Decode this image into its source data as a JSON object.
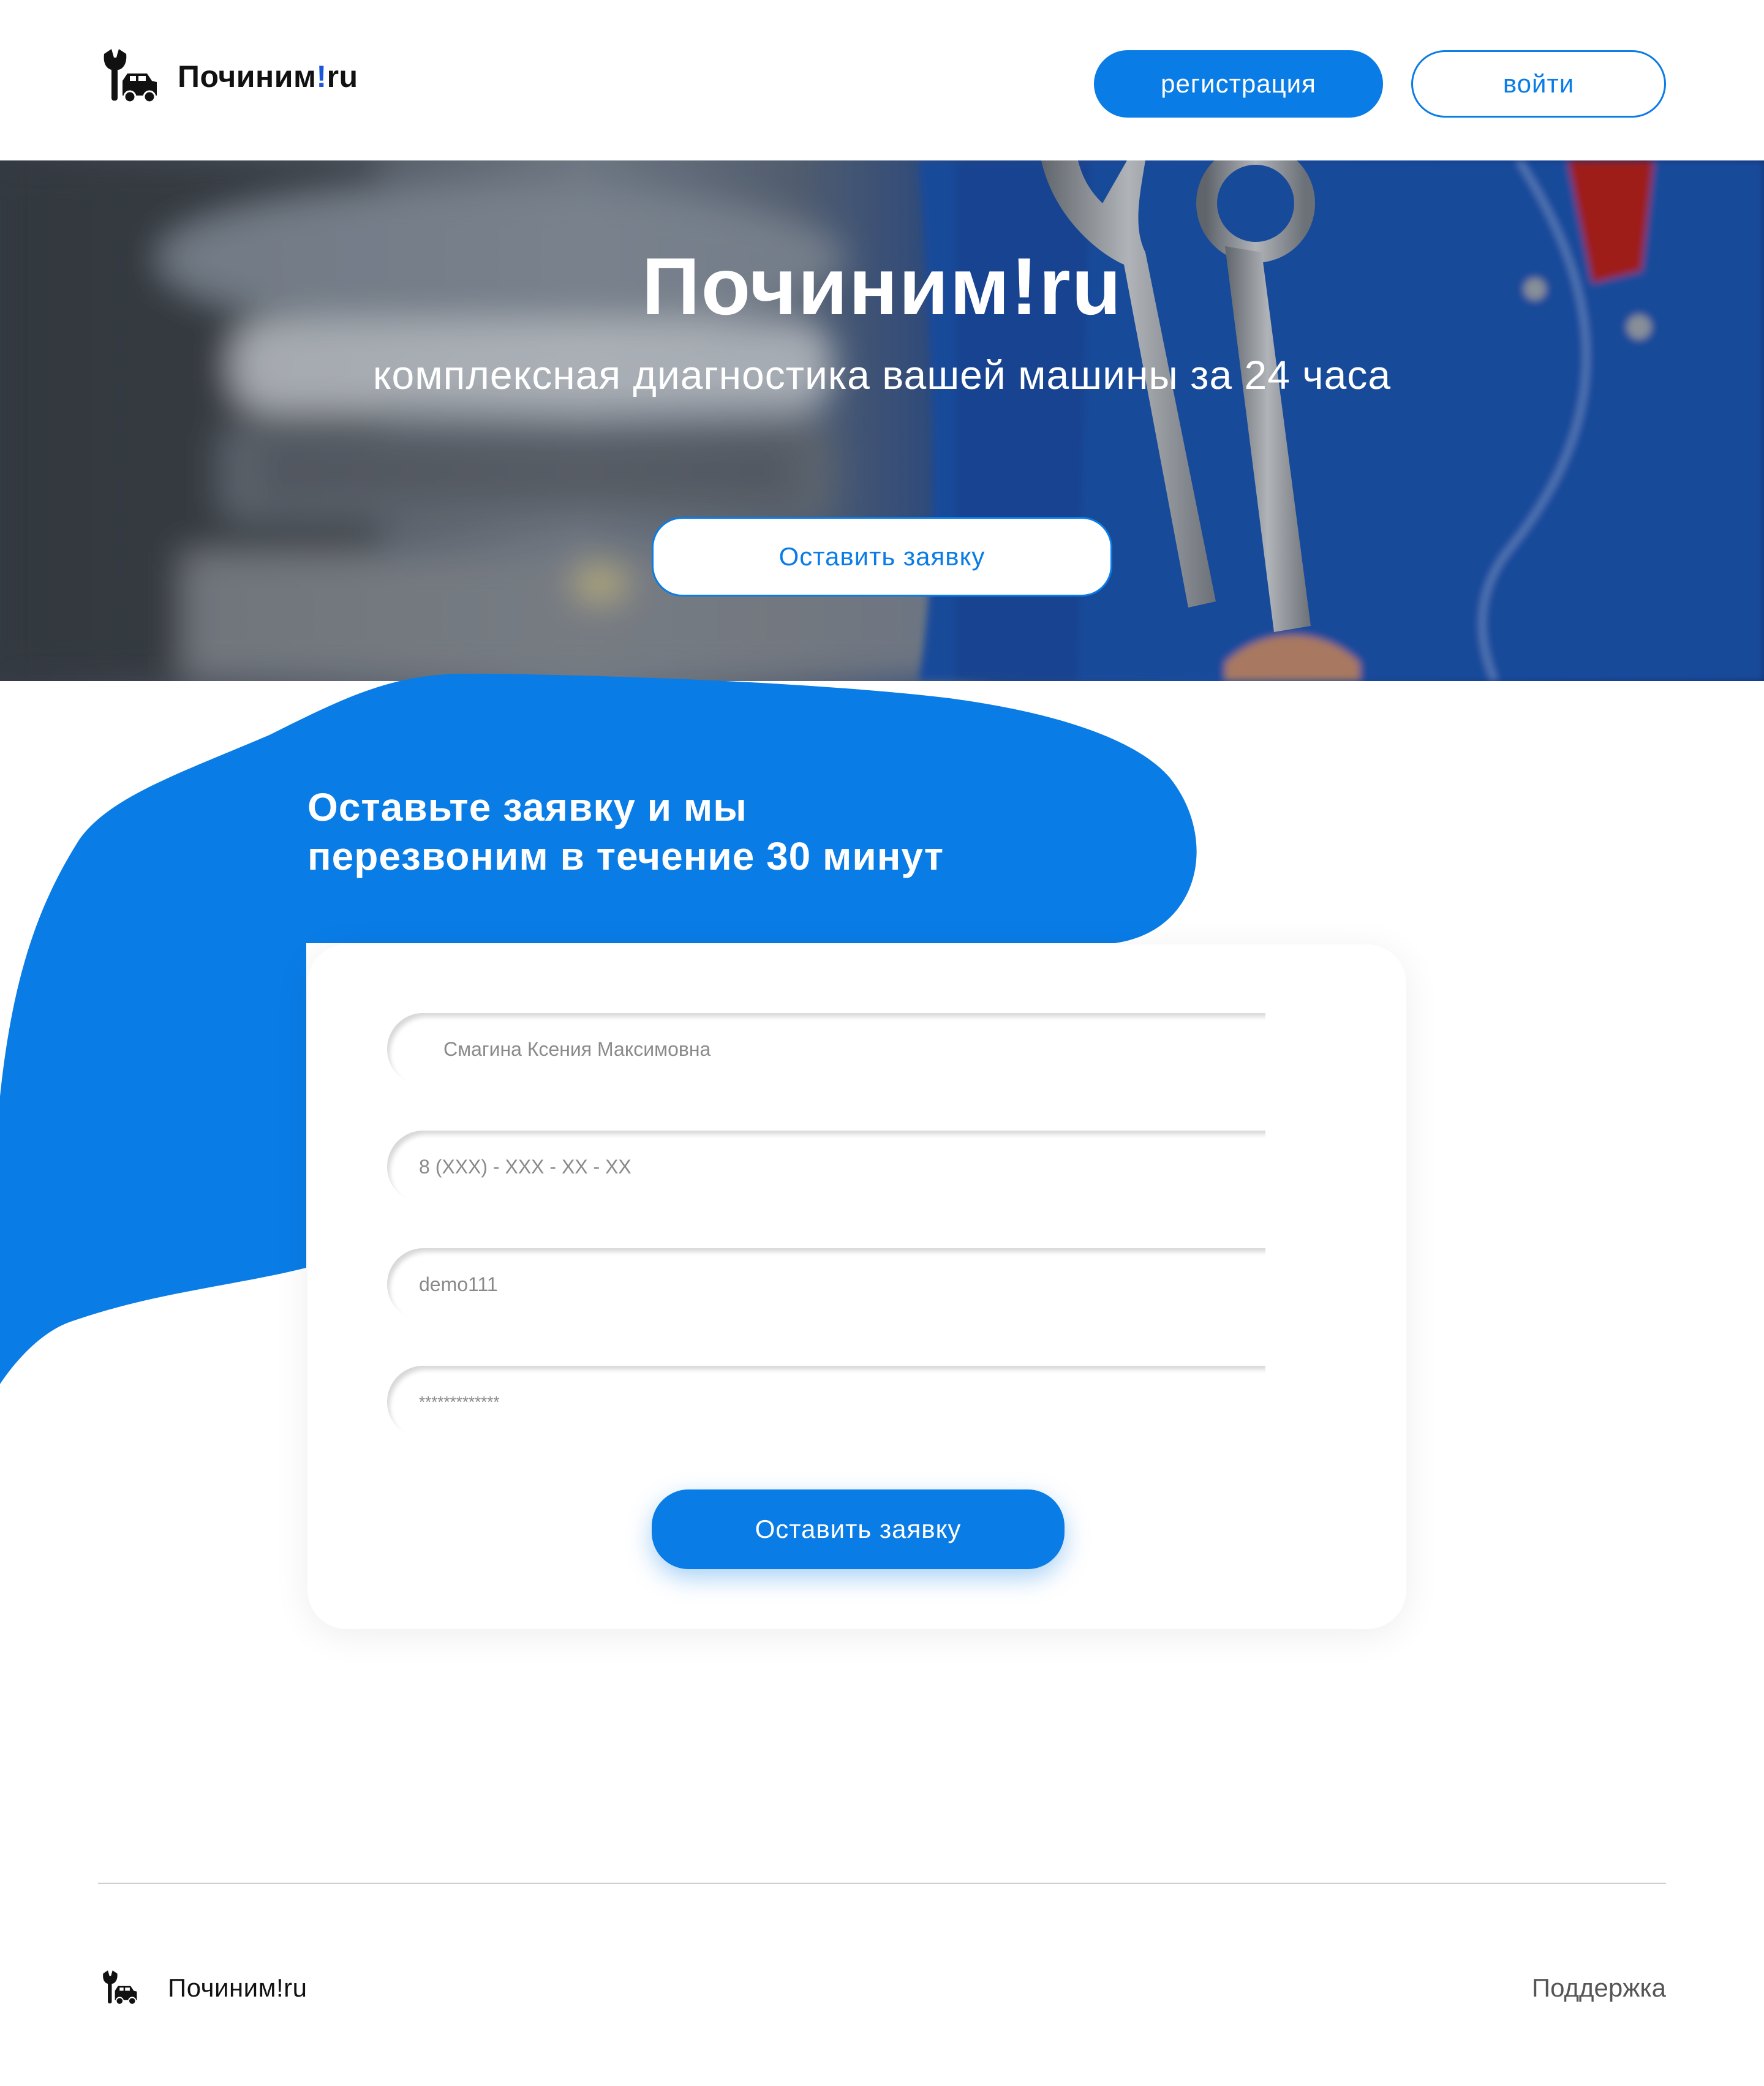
{
  "header": {
    "logo_text_main": "Починим",
    "logo_text_excl": "!",
    "logo_text_tail": "ru",
    "register_label": "регистрация",
    "login_label": "войти"
  },
  "hero": {
    "title": "Починим!ru",
    "subtitle": "комплексная диагностика вашей машины за 24 часа",
    "cta_label": "Оставить заявку"
  },
  "request_form": {
    "heading_line1": "Оставьте заявку и мы",
    "heading_line2": "перезвоним в течение 30 минут",
    "name_value": "Смагина Ксения Максимовна",
    "phone_placeholder": "8 (XXX) - XXX - XX - XX",
    "login_value": "demo111",
    "password_value": "*************",
    "submit_label": "Оставить заявку"
  },
  "footer": {
    "logo_text": "Починим!ru",
    "support_label": "Поддержка"
  },
  "colors": {
    "accent": "#0a7ce6",
    "logo_exclamation": "#1a56db"
  },
  "icons": {
    "logo": "wrench-car-icon"
  }
}
